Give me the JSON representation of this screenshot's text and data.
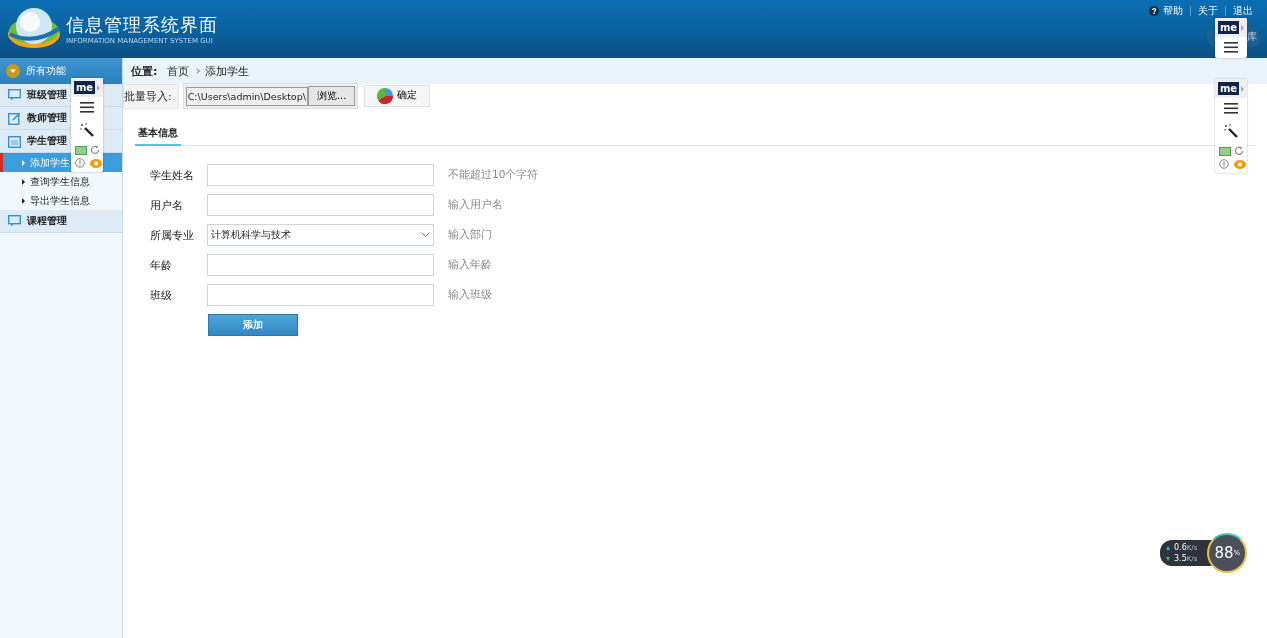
{
  "header": {
    "title": "信息管理系统界面",
    "subtitle": "INFORMATION MANAGEMENT SYSTEM GUI",
    "links": [
      "帮助",
      "关于",
      "退出"
    ],
    "pill_button": "库"
  },
  "sidebar": {
    "title": "所有功能",
    "groups": [
      {
        "label": "班级管理"
      },
      {
        "label": "教师管理"
      },
      {
        "label": "学生管理",
        "children": [
          {
            "label": "添加学生",
            "selected": true
          },
          {
            "label": "查询学生信息",
            "selected": false
          },
          {
            "label": "导出学生信息",
            "selected": false
          }
        ]
      },
      {
        "label": "课程管理"
      }
    ]
  },
  "breadcrumb": {
    "label": "位置:",
    "items": [
      "首页",
      "添加学生"
    ]
  },
  "import": {
    "label": "批量导入:",
    "path": "C:\\Users\\admin\\Desktop\\",
    "browse": "浏览...",
    "confirm": "确定"
  },
  "tabs": [
    {
      "label": "基本信息",
      "selected": true
    }
  ],
  "form": [
    {
      "label": "学生姓名",
      "kind": "text",
      "hint": "不能超过10个字符"
    },
    {
      "label": "用户名",
      "kind": "text",
      "hint": "输入用户名"
    },
    {
      "label": "所属专业",
      "kind": "select",
      "value": "计算机科学与技术",
      "hint": "输入部门"
    },
    {
      "label": "年龄",
      "kind": "text",
      "hint": "输入年龄"
    },
    {
      "label": "班级",
      "kind": "text",
      "hint": "输入班级"
    }
  ],
  "submit": "添加",
  "overlays": {
    "toolbars": [
      {
        "kind": "full",
        "logo": "me"
      },
      {
        "kind": "partial",
        "logo": "me"
      },
      {
        "kind": "full",
        "logo": "me"
      }
    ],
    "speed_widget": {
      "upload": "0.6",
      "upload_unit": "K/s",
      "download": "3.5",
      "download_unit": "K/s",
      "percent": "88",
      "percent_unit": "%"
    }
  }
}
